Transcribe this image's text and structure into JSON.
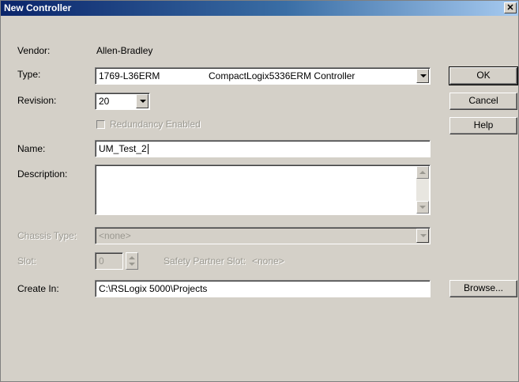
{
  "window": {
    "title": "New Controller",
    "close_glyph": "✕"
  },
  "vendor": {
    "label": "Vendor:",
    "value": "Allen-Bradley"
  },
  "type": {
    "label": "Type:",
    "catalog": "1769-L36ERM",
    "description": "CompactLogix5336ERM Controller"
  },
  "revision": {
    "label": "Revision:",
    "value": "20"
  },
  "redundancy": {
    "label": "Redundancy Enabled",
    "checked": false,
    "enabled": false
  },
  "name": {
    "label": "Name:",
    "value": "UM_Test_2"
  },
  "description": {
    "label": "Description:",
    "value": ""
  },
  "chassis_type": {
    "label": "Chassis Type:",
    "value": "<none>",
    "enabled": false
  },
  "slot": {
    "label": "Slot:",
    "value": "0",
    "safety_partner_label": "Safety Partner Slot:",
    "safety_partner_value": "<none>",
    "enabled": false
  },
  "create_in": {
    "label": "Create In:",
    "value": "C:\\RSLogix 5000\\Projects"
  },
  "buttons": {
    "ok": "OK",
    "cancel": "Cancel",
    "help": "Help",
    "browse": "Browse..."
  },
  "icons": {
    "dropdown": "chevron-down-icon",
    "close": "close-icon",
    "spin": "spin-arrows-icon"
  }
}
